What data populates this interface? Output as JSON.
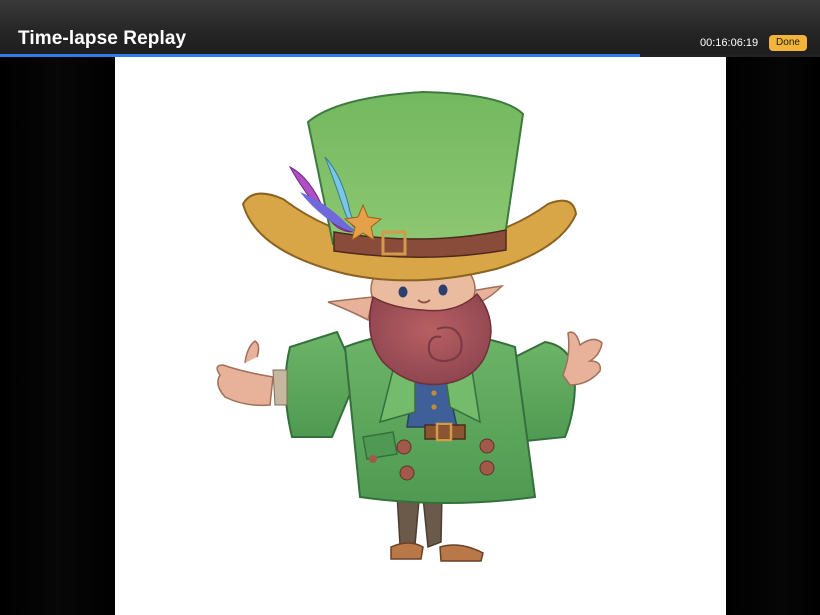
{
  "header": {
    "title": "Time-lapse Replay",
    "timestamp": "00:16:06:19",
    "done_label": "Done"
  },
  "playback": {
    "progress_fraction": 0.78
  },
  "colors": {
    "accent_progress": "#2f7de8",
    "done_button": "#f2b53a",
    "hat_green": "#7cc06a",
    "hat_brim": "#d9a84a",
    "coat_green": "#5faa5e",
    "beard": "#a2505a"
  },
  "canvas": {
    "artwork": "leprechaun character illustration"
  }
}
